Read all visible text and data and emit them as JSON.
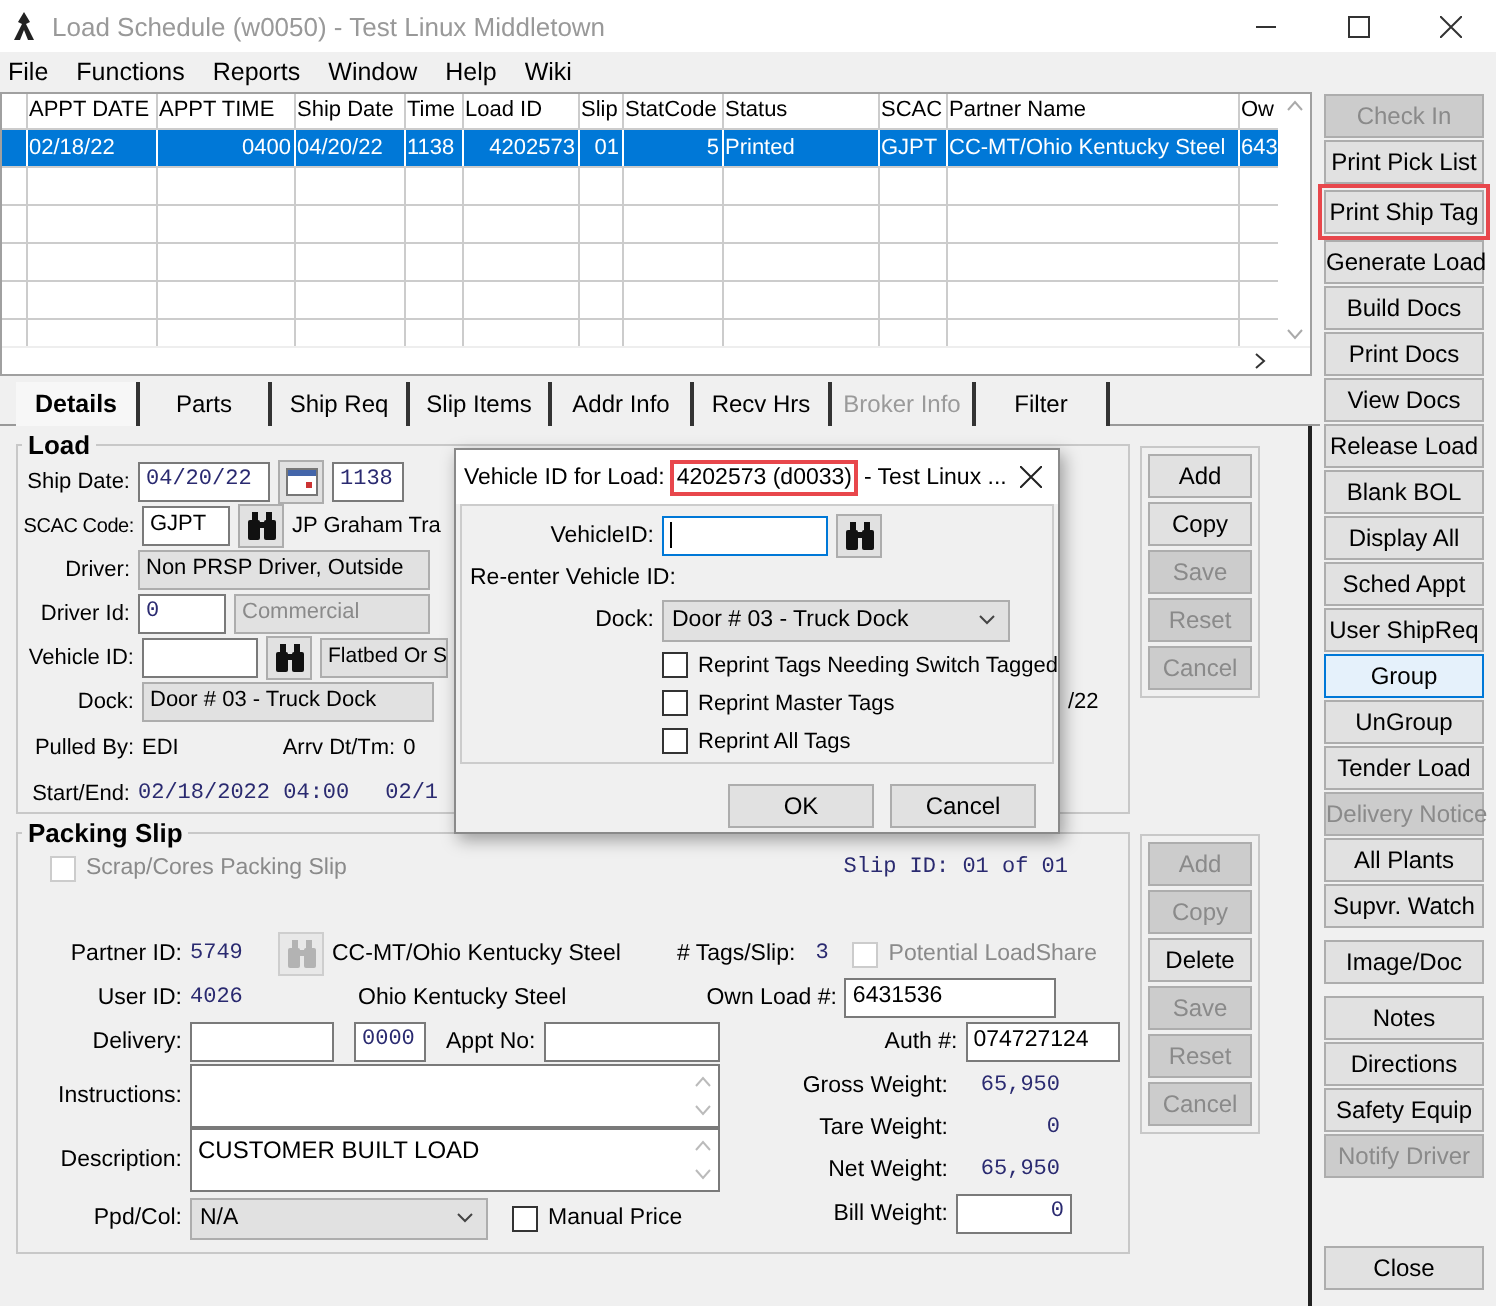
{
  "window": {
    "title": "Load Schedule (w0050) - Test Linux Middletown"
  },
  "menu": [
    "File",
    "Functions",
    "Reports",
    "Window",
    "Help",
    "Wiki"
  ],
  "grid": {
    "columns": [
      "APPT DATE",
      "APPT TIME",
      "Ship Date",
      "Time",
      "Load ID",
      "Slip",
      "StatCode",
      "Status",
      "SCAC",
      "Partner Name",
      "Ow"
    ],
    "rows": [
      {
        "selected": true,
        "cells": [
          "02/18/22",
          "0400",
          "04/20/22",
          "1138",
          "4202573",
          "01",
          "5",
          "Printed",
          "GJPT",
          "CC-MT/Ohio Kentucky Steel",
          "643"
        ]
      }
    ]
  },
  "tabs": [
    {
      "label": "Details",
      "selected": true,
      "disabled": false
    },
    {
      "label": "Parts",
      "selected": false,
      "disabled": false
    },
    {
      "label": "Ship Req",
      "selected": false,
      "disabled": false
    },
    {
      "label": "Slip Items",
      "selected": false,
      "disabled": false
    },
    {
      "label": "Addr Info",
      "selected": false,
      "disabled": false
    },
    {
      "label": "Recv Hrs",
      "selected": false,
      "disabled": false
    },
    {
      "label": "Broker Info",
      "selected": false,
      "disabled": true
    },
    {
      "label": "Filter",
      "selected": false,
      "disabled": false
    }
  ],
  "load": {
    "title": "Load",
    "ship_date": {
      "label": "Ship Date:",
      "value": "04/20/22",
      "time": "1138"
    },
    "scac": {
      "label": "SCAC Code:",
      "value": "GJPT",
      "carrier": "JP Graham Tra"
    },
    "driver": {
      "label": "Driver:",
      "value": "Non PRSP Driver, Outside"
    },
    "driver_id": {
      "label": "Driver Id:",
      "value": "0",
      "type": "Commercial"
    },
    "vehicle_id": {
      "label": "Vehicle ID:",
      "equipment": "Flatbed Or S"
    },
    "dock": {
      "label": "Dock:",
      "value": "Door # 03 - Truck Dock"
    },
    "pulled_by": {
      "label": "Pulled By:",
      "value": "EDI"
    },
    "arrival": {
      "label": "Arrv Dt/Tm:",
      "value": "0"
    },
    "start_end": {
      "label": "Start/End:",
      "start": "02/18/2022 04:00",
      "end": "02/1"
    },
    "date_partial": "/22",
    "buttons": [
      {
        "label": "Add",
        "disabled": false
      },
      {
        "label": "Copy",
        "disabled": false
      },
      {
        "label": "Save",
        "disabled": true
      },
      {
        "label": "Reset",
        "disabled": true
      },
      {
        "label": "Cancel",
        "disabled": true
      }
    ]
  },
  "packing_slip": {
    "title": "Packing Slip",
    "scrap_cores": {
      "label": "Scrap/Cores Packing Slip",
      "checked": false
    },
    "slip_id": "Slip ID:  01  of  01",
    "partner_id": {
      "label": "Partner ID:",
      "value": "5749",
      "name": "CC-MT/Ohio Kentucky Steel"
    },
    "user_id": {
      "label": "User ID:",
      "value": "4026",
      "name": "Ohio Kentucky Steel"
    },
    "delivery": {
      "label": "Delivery:",
      "time": "0000"
    },
    "appt_no": {
      "label": "Appt No:"
    },
    "instructions": {
      "label": "Instructions:"
    },
    "description": {
      "label": "Description:",
      "value": "CUSTOMER BUILT LOAD"
    },
    "ppd_col": {
      "label": "Ppd/Col:",
      "value": "N/A"
    },
    "manual_price": {
      "label": "Manual Price",
      "checked": false
    },
    "tags_per_slip": {
      "label": "# Tags/Slip:",
      "value": "3"
    },
    "potential_loadshare": {
      "label": "Potential LoadShare",
      "checked": false
    },
    "own_load": {
      "label": "Own Load #:",
      "value": "6431536"
    },
    "auth": {
      "label": "Auth #:",
      "value": "074727124"
    },
    "gross_weight": {
      "label": "Gross Weight:",
      "value": "65,950"
    },
    "tare_weight": {
      "label": "Tare Weight:",
      "value": "0"
    },
    "net_weight": {
      "label": "Net Weight:",
      "value": "65,950"
    },
    "bill_weight": {
      "label": "Bill Weight:",
      "value": "0"
    },
    "buttons": [
      {
        "label": "Add",
        "disabled": true
      },
      {
        "label": "Copy",
        "disabled": true
      },
      {
        "label": "Delete",
        "disabled": false
      },
      {
        "label": "Save",
        "disabled": true
      },
      {
        "label": "Reset",
        "disabled": true
      },
      {
        "label": "Cancel",
        "disabled": true
      }
    ]
  },
  "side_buttons": [
    [
      {
        "label": "Check In",
        "disabled": true,
        "focused": false,
        "highlighted": false
      },
      {
        "label": "Print Pick List",
        "disabled": false,
        "focused": false,
        "highlighted": false
      },
      {
        "label": "Print Ship Tag",
        "disabled": false,
        "focused": false,
        "highlighted": true
      },
      {
        "label": "Generate Load",
        "disabled": false,
        "focused": false,
        "highlighted": false
      },
      {
        "label": "Build Docs",
        "disabled": false,
        "focused": false,
        "highlighted": false
      },
      {
        "label": "Print Docs",
        "disabled": false,
        "focused": false,
        "highlighted": false
      },
      {
        "label": "View Docs",
        "disabled": false,
        "focused": false,
        "highlighted": false
      },
      {
        "label": "Release Load",
        "disabled": false,
        "focused": false,
        "highlighted": false
      },
      {
        "label": "Blank BOL",
        "disabled": false,
        "focused": false,
        "highlighted": false
      },
      {
        "label": "Display All",
        "disabled": false,
        "focused": false,
        "highlighted": false
      },
      {
        "label": "Sched Appt",
        "disabled": false,
        "focused": false,
        "highlighted": false
      },
      {
        "label": "User ShipReq",
        "disabled": false,
        "focused": false,
        "highlighted": false
      },
      {
        "label": "Group",
        "disabled": false,
        "focused": true,
        "highlighted": false
      },
      {
        "label": "UnGroup",
        "disabled": false,
        "focused": false,
        "highlighted": false
      },
      {
        "label": "Tender Load",
        "disabled": false,
        "focused": false,
        "highlighted": false
      },
      {
        "label": "Delivery Notice",
        "disabled": true,
        "focused": false,
        "highlighted": false
      },
      {
        "label": "All Plants",
        "disabled": false,
        "focused": false,
        "highlighted": false
      },
      {
        "label": "Supvr. Watch",
        "disabled": false,
        "focused": false,
        "highlighted": false
      }
    ],
    [
      {
        "label": "Image/Doc",
        "disabled": false,
        "focused": false,
        "highlighted": false
      }
    ],
    [
      {
        "label": "Notes",
        "disabled": false,
        "focused": false,
        "highlighted": false
      },
      {
        "label": "Directions",
        "disabled": false,
        "focused": false,
        "highlighted": false
      },
      {
        "label": "Safety Equip",
        "disabled": false,
        "focused": false,
        "highlighted": false
      },
      {
        "label": "Notify Driver",
        "disabled": true,
        "focused": false,
        "highlighted": false
      }
    ],
    [
      {
        "label": "Close",
        "disabled": false,
        "focused": false,
        "highlighted": false
      }
    ]
  ],
  "dialog": {
    "title_prefix": "Vehicle ID for Load:",
    "load_number": "4202573 (d0033)",
    "load_highlighted": true,
    "title_suffix": "- Test Linux ...",
    "vehicle_id_label": "VehicleID:",
    "reenter_label": "Re-enter Vehicle ID:",
    "dock": {
      "label": "Dock:",
      "value": "Door # 03 - Truck Dock"
    },
    "options": [
      {
        "label": "Reprint Tags Needing Switch Tagged",
        "checked": false
      },
      {
        "label": "Reprint Master Tags",
        "checked": false
      },
      {
        "label": "Reprint All Tags",
        "checked": false
      }
    ],
    "buttons": [
      "OK",
      "Cancel"
    ]
  }
}
